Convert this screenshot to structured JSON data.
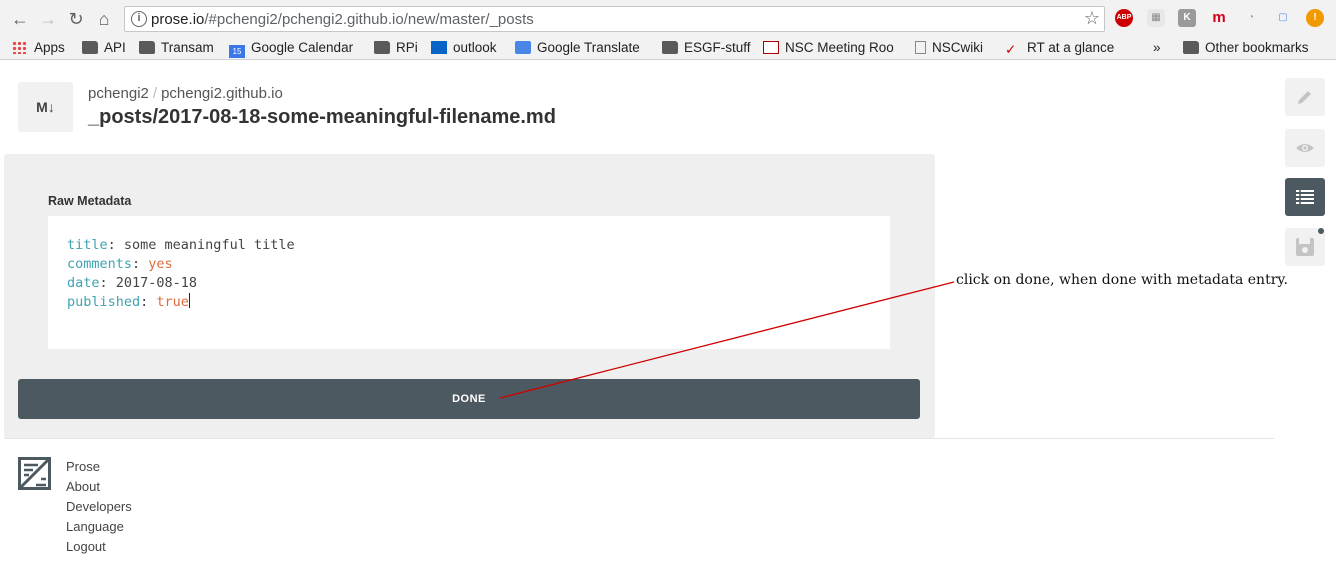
{
  "browser": {
    "url_host": "prose.io",
    "url_path": "/#pchengi2/pchengi2.github.io/new/master/_posts",
    "extensions": [
      {
        "name": "abp-icon",
        "label": "ABP",
        "color": "#c00"
      },
      {
        "name": "mendeley-icon",
        "label": "m",
        "color": "#d0021b"
      },
      {
        "name": "alert-icon",
        "label": "!",
        "color": "#f29900"
      }
    ]
  },
  "bookmarks": {
    "items": [
      "Apps",
      "API",
      "Transam",
      "Google Calendar",
      "RPi",
      "outlook",
      "Google Translate",
      "ESGF-stuff",
      "NSC Meeting Roo",
      "NSCwiki",
      "RT at a glance"
    ],
    "overflow": "»",
    "other": "Other bookmarks",
    "calendar_day": "15"
  },
  "header": {
    "logo": "M↓",
    "owner": "pchengi2",
    "separator": "/",
    "repo": "pchengi2.github.io",
    "file_path": "_posts/2017-08-18-some-meaningful-filename.md"
  },
  "metadata": {
    "label": "Raw Metadata",
    "lines": [
      {
        "key": "title",
        "sep": ": ",
        "value": "some meaningful title",
        "value_style": "plain"
      },
      {
        "key": "comments",
        "sep": ": ",
        "value": "yes",
        "value_style": "literal"
      },
      {
        "key": "date",
        "sep": ": ",
        "value": "2017-08-18",
        "value_style": "plain"
      },
      {
        "key": "published",
        "sep": ": ",
        "value": "true",
        "value_style": "literal"
      }
    ],
    "done_label": "DONE"
  },
  "footer": {
    "links": [
      "Prose",
      "About",
      "Developers",
      "Language",
      "Logout"
    ]
  },
  "annotation": {
    "text": "click on done, when done with metadata entry.",
    "color": "#d00000"
  },
  "colors": {
    "accent_dark": "#4d5960",
    "yaml_key": "#3fa4b0",
    "yaml_literal": "#e06c3c"
  }
}
